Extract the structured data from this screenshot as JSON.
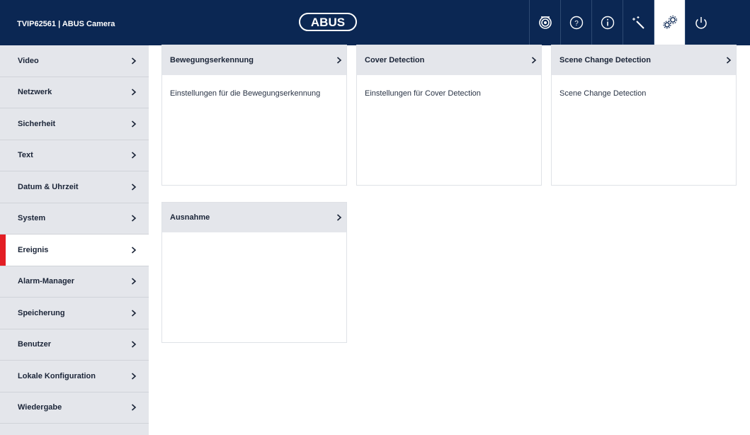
{
  "header": {
    "product_title": "TVIP62561  |  ABUS Camera",
    "logo_text": "ABUS",
    "icons": [
      "camera-icon",
      "help-icon",
      "info-icon",
      "wizard-icon",
      "settings-icon",
      "power-icon"
    ],
    "active_icon": "settings-icon"
  },
  "sidebar": {
    "items": [
      {
        "label": "Video"
      },
      {
        "label": "Netzwerk"
      },
      {
        "label": "Sicherheit"
      },
      {
        "label": "Text"
      },
      {
        "label": "Datum & Uhrzeit"
      },
      {
        "label": "System"
      },
      {
        "label": "Ereignis"
      },
      {
        "label": "Alarm-Manager"
      },
      {
        "label": "Speicherung"
      },
      {
        "label": "Benutzer"
      },
      {
        "label": "Lokale Konfiguration"
      },
      {
        "label": "Wiedergabe"
      }
    ],
    "active_item": "Ereignis"
  },
  "cards": [
    {
      "title": "Bewegungserkennung",
      "description": "Einstellungen für die Bewegungserkennung"
    },
    {
      "title": "Cover Detection",
      "description": "Einstellungen für Cover Detection"
    },
    {
      "title": "Scene Change Detection",
      "description": "Scene Change Detection"
    },
    {
      "title": "Ausnahme",
      "description": ""
    }
  ],
  "colors": {
    "header_bg": "#0b2753",
    "sidebar_bg": "#e4e6eb",
    "active_marker": "#e31e24",
    "text": "#1b2538"
  }
}
